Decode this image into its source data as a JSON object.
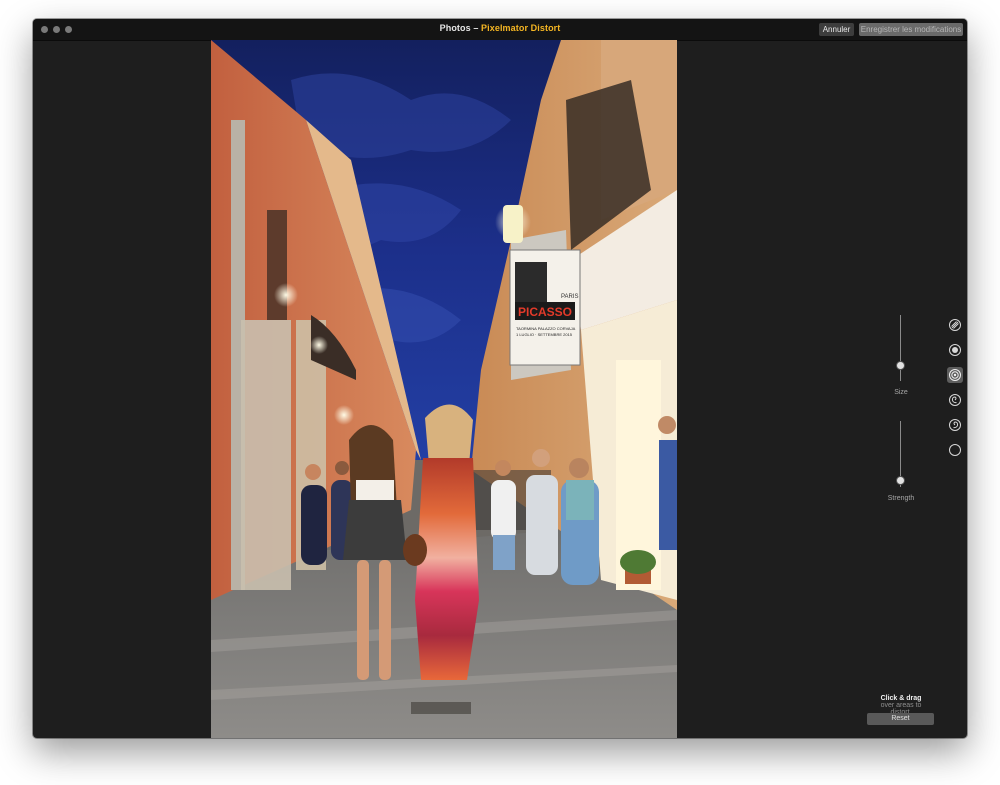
{
  "window": {
    "title_app": "Photos",
    "title_separator": " – ",
    "title_extension": "Pixelmator Distort"
  },
  "toolbar": {
    "cancel_label": "Annuler",
    "save_label": "Enregistrer les modifications"
  },
  "photo": {
    "poster_name": "PICASSO",
    "poster_small": "PARIS",
    "poster_line1": "TAORMINA PALAZZO CORVAJA",
    "poster_line2": "1 LUGLIO · SETTEMBRE 2015"
  },
  "sidebar": {
    "size_label": "Size",
    "strength_label": "Strength",
    "size_value": 0.25,
    "strength_value": 0.1,
    "tools": [
      {
        "name": "smudge-tool-icon",
        "selected": false
      },
      {
        "name": "bump-tool-icon",
        "selected": false
      },
      {
        "name": "pinch-tool-icon",
        "selected": true
      },
      {
        "name": "twirl-cw-tool-icon",
        "selected": false
      },
      {
        "name": "twirl-ccw-tool-icon",
        "selected": false
      },
      {
        "name": "restore-tool-icon",
        "selected": false
      }
    ],
    "hint_title": "Click & drag",
    "hint_line1": "over areas to",
    "hint_line2": "distort.",
    "reset_label": "Reset"
  },
  "colors": {
    "accent": "#f5b623",
    "panel_bg": "#1e1e1e",
    "sky": "#1a2a7a"
  }
}
